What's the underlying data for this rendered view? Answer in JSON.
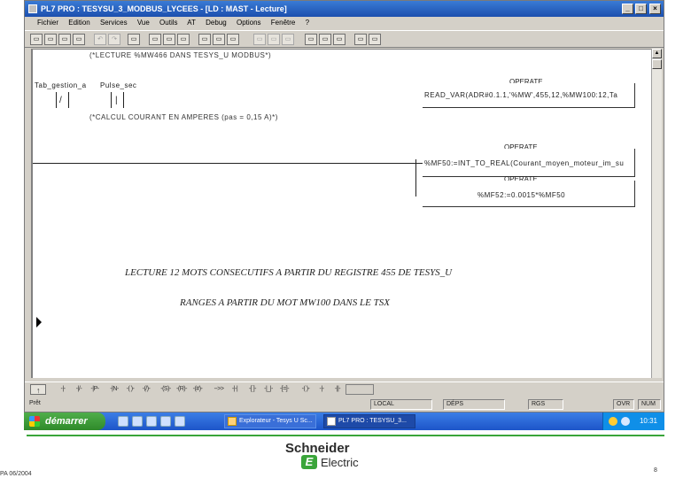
{
  "window": {
    "title": "PL7 PRO : TESYSU_3_MODBUS_LYCEES - [LD : MAST - Lecture]",
    "btn_min": "_",
    "btn_max": "□",
    "btn_close": "×"
  },
  "menu": {
    "items": [
      "Fichier",
      "Edition",
      "Services",
      "Vue",
      "Outils",
      "AT",
      "Debug",
      "Options",
      "Fenêtre",
      "?"
    ]
  },
  "toolbar": {
    "buttons": [
      "▭",
      "▭",
      "▭",
      "▭",
      "↶",
      "↷",
      "▭",
      "▭",
      "▭",
      "▭",
      "▭",
      "▭",
      "▭",
      "▭",
      "▭",
      "▭",
      "▭",
      "▭",
      "▭",
      "▭",
      "▭",
      "▭"
    ]
  },
  "ladder": {
    "comment1": "(*LECTURE %MW466 DANS TESYS_U MODBUS*)",
    "contact1_label": "Tab_gestion_a",
    "contact2_label": "Pulse_sec",
    "contact1_symbol": "/",
    "contact2_symbol": "|",
    "operate1_header": "OPERATE",
    "operate1_expr": "READ_VAR(ADR#0.1.1,'%MW',455,12,%MW100:12,Ta",
    "comment2": "(*CALCUL COURANT EN AMPERES (pas = 0,15 A)*)",
    "operate2_header": "OPERATE",
    "operate2_expr": "%MF50:=INT_TO_REAL(Courant_moyen_moteur_im_su",
    "operate3_header": "OPERATE",
    "operate3_expr": "%MF52:=0.0015*%MF50"
  },
  "comments": {
    "line1": "LECTURE 12 MOTS CONSECUTIFS A PARTIR DU REGISTRE 455 DE TESYS_U",
    "line2": "RANGES A PARTIR DU MOT MW100 DANS LE TSX"
  },
  "funckeys": {
    "first": "↑",
    "keys": [
      "-|-",
      "-|/-",
      "-|P-",
      "-|N-",
      "-( )-",
      "-(/)-",
      "-(S)-",
      "-(R)-",
      "-(#)-",
      "-->>",
      "-|-|",
      "-[ ]-",
      "-|_|-",
      "-[=]-",
      "-( )-",
      "-|-",
      "-||-",
      "-|-",
      "-//-",
      "-|-",
      "-|-",
      "-|-",
      "-|-",
      "-|-"
    ]
  },
  "status": {
    "left": "Prêt",
    "local": "LOCAL",
    "mode": "DÉPS",
    "rgs": "RGS",
    "ovr": "OVR",
    "num": "NUM"
  },
  "taskbar": {
    "start_label": "démarrer",
    "task1": "Explorateur - Tesys U Sc...",
    "task2": "PL7 PRO : TESYSU_3...",
    "clock": "10:31"
  },
  "footer": {
    "brand": "Schneider",
    "brand_sub": "Electric",
    "logo_mark": "E",
    "ref": "PA 06/2004",
    "page": "8"
  },
  "colors": {
    "title_blue": "#1c4fae",
    "taskbar_blue": "#1d55c9",
    "start_green": "#2f8a2a",
    "schneider_green": "#3aa53a"
  }
}
